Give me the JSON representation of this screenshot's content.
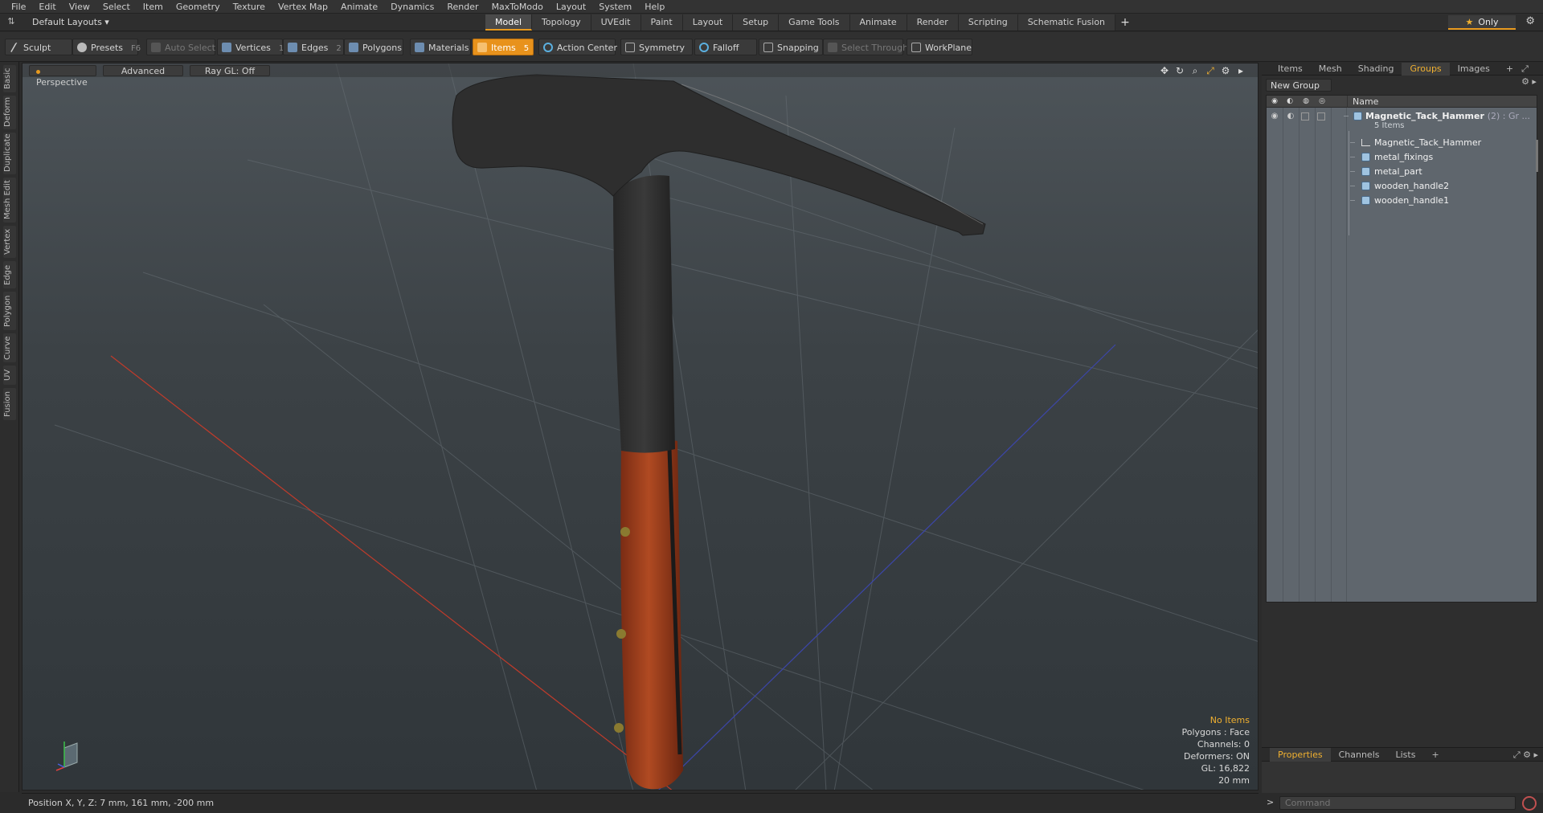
{
  "menu": [
    "File",
    "Edit",
    "View",
    "Select",
    "Item",
    "Geometry",
    "Texture",
    "Vertex Map",
    "Animate",
    "Dynamics",
    "Render",
    "MaxToModo",
    "Layout",
    "System",
    "Help"
  ],
  "layoutbar": {
    "layouts_label": "Default Layouts ▾",
    "tabs": [
      "Model",
      "Topology",
      "UVEdit",
      "Paint",
      "Layout",
      "Setup",
      "Game Tools",
      "Animate",
      "Render",
      "Scripting",
      "Schematic Fusion"
    ],
    "active_tab": "Model",
    "add_tab": "+",
    "only_label": "Only"
  },
  "toolbar": {
    "sculpt": "Sculpt",
    "presets": "Presets",
    "presets_key": "F6",
    "auto_select": "Auto Select",
    "vertices": "Vertices",
    "vertices_count": "1",
    "edges": "Edges",
    "edges_count": "2",
    "polygons": "Polygons",
    "materials": "Materials",
    "items": "Items",
    "items_count": "5",
    "action_center": "Action Center",
    "symmetry": "Symmetry",
    "falloff": "Falloff",
    "snapping": "Snapping",
    "select_through": "Select Through",
    "workplane": "WorkPlane"
  },
  "leftstrip": [
    "Basic",
    "Deform",
    "Duplicate",
    "Mesh Edit",
    "Vertex",
    "Edge",
    "Polygon",
    "Curve",
    "UV",
    "Fusion"
  ],
  "viewport": {
    "view_mode": "Perspective",
    "shading": "Advanced",
    "raygl": "Ray GL: Off",
    "info": {
      "selection": "No Items",
      "polygons": "Polygons : Face",
      "channels": "Channels: 0",
      "deformers": "Deformers: ON",
      "gl": "GL: 16,822",
      "scale": "20 mm"
    },
    "colors": {
      "handle_wood": "#9a3a1e",
      "head_metal": "#2c2c2c",
      "grid_red": "#c03b2b",
      "grid_blue": "#3c46a8"
    }
  },
  "rightpanel": {
    "tabs": [
      "Items",
      "Mesh ...",
      "Shading",
      "Groups",
      "Images"
    ],
    "active_tab": "Groups",
    "add_tab": "+",
    "new_group": "New Group",
    "column_name": "Name",
    "group": {
      "name": "Magnetic_Tack_Hammer",
      "meta": "(2) : Gr ...",
      "count_label": "5 Items",
      "children": [
        {
          "name": "Magnetic_Tack_Hammer",
          "type": "locator"
        },
        {
          "name": "metal_fixings",
          "type": "mesh"
        },
        {
          "name": "metal_part",
          "type": "mesh"
        },
        {
          "name": "wooden_handle2",
          "type": "mesh"
        },
        {
          "name": "wooden_handle1",
          "type": "mesh"
        }
      ]
    },
    "prop_tabs": [
      "Properties",
      "Channels",
      "Lists"
    ],
    "prop_active": "Properties"
  },
  "statusbar": {
    "position": "Position X, Y, Z:  7 mm, 161 mm, -200 mm"
  },
  "command": {
    "placeholder": "Command"
  }
}
